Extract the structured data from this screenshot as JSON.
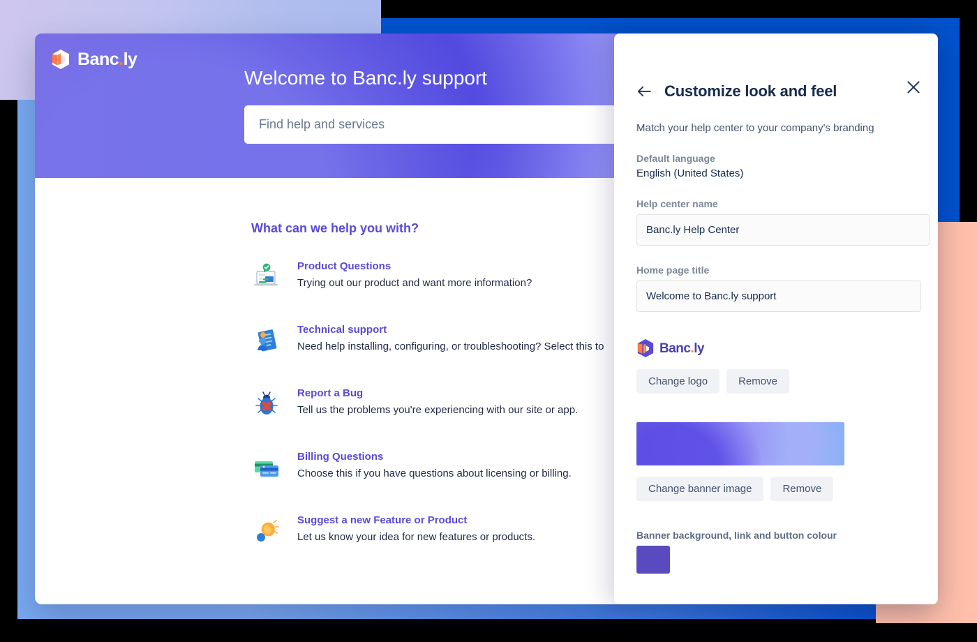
{
  "helpcenter": {
    "logo_text": "Banc",
    "logo_suffix": "ly",
    "logo_dot": ".",
    "title": "Welcome to Banc.ly support",
    "search_placeholder": "Find help and services",
    "search_value": "",
    "section_title": "What can we help you with?",
    "topics": [
      {
        "title": "Product Questions",
        "desc": "Trying out our product and want more information?",
        "icon": "laptop-check-icon"
      },
      {
        "title": "Technical support",
        "desc": "Need help installing, configuring, or troubleshooting? Select this to",
        "icon": "support-card-icon"
      },
      {
        "title": "Report a Bug",
        "desc": "Tell us the problems you're experiencing with our site or app.",
        "icon": "bug-icon"
      },
      {
        "title": "Billing Questions",
        "desc": "Choose this if you have questions about licensing or billing.",
        "icon": "credit-card-icon"
      },
      {
        "title": "Suggest a new Feature or Product",
        "desc": "Let us know your idea for new features or products.",
        "icon": "lightbulb-idea-icon"
      }
    ]
  },
  "panel": {
    "close_icon": "close-icon",
    "back_icon": "back-arrow-icon",
    "title": "Customize look and feel",
    "subtitle": "Match your help center to your company's branding",
    "default_language_label": "Default language",
    "default_language_value": "English (United States)",
    "help_center_name_label": "Help center name",
    "help_center_name_value": "Banc.ly Help Center",
    "home_page_title_label": "Home page title",
    "home_page_title_value": "Welcome to Banc.ly support",
    "logo_text": "Banc",
    "logo_dot": ".",
    "logo_suffix": "ly",
    "change_logo_label": "Change logo",
    "remove_logo_label": "Remove",
    "change_banner_label": "Change banner image",
    "remove_banner_label": "Remove",
    "colour_label": "Banner background, link and button colour",
    "colour_value": "#5a4ac0"
  },
  "colors": {
    "brand_purple": "#5a4ad6",
    "accent_orange": "#ff7a45",
    "bg_blue": "#0052cc",
    "bg_salmon": "#ffbfaa",
    "bg_lavender": "#cfc6ee",
    "swatch": "#5a4ac0"
  }
}
